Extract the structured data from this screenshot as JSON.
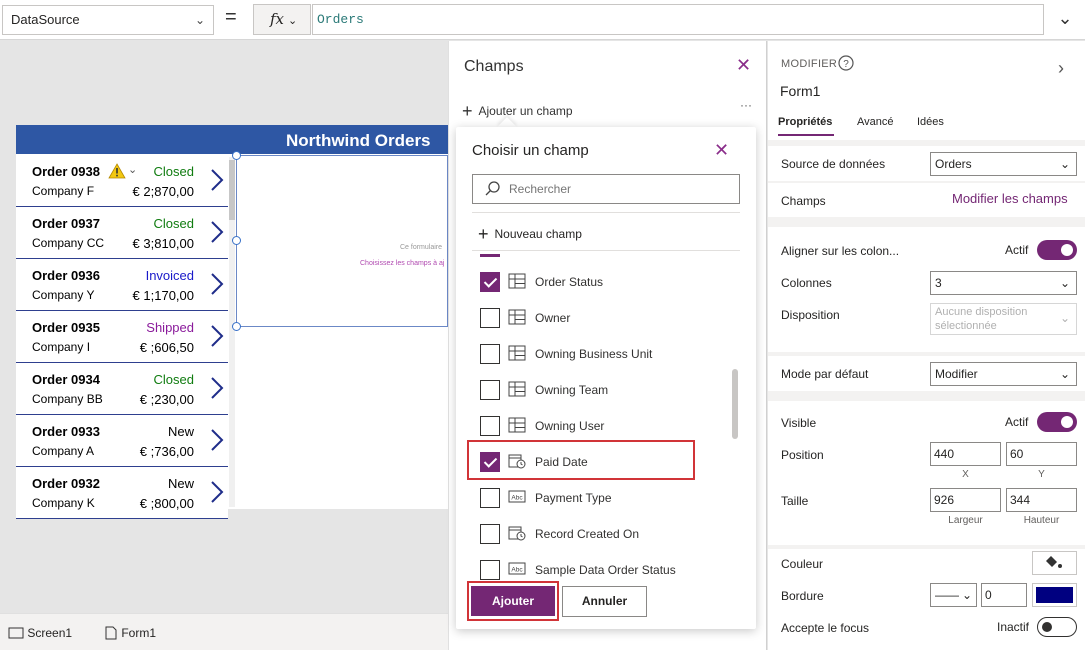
{
  "formula_bar": {
    "property": "DataSource",
    "equals": "=",
    "fx": "fx",
    "formula": "Orders"
  },
  "app": {
    "title": "Northwind Orders",
    "orders": [
      {
        "id": "Order 0938",
        "company": "Company F",
        "status": "Closed",
        "amount": "€ 2;870,00",
        "status_color": "#107c10"
      },
      {
        "id": "Order 0937",
        "company": "Company CC",
        "status": "Closed",
        "amount": "€ 3;810,00",
        "status_color": "#107c10"
      },
      {
        "id": "Order 0936",
        "company": "Company Y",
        "status": "Invoiced",
        "amount": "€ 1;170,00",
        "status_color": "#1a1ac9"
      },
      {
        "id": "Order 0935",
        "company": "Company I",
        "status": "Shipped",
        "amount": "€ ;606,50",
        "status_color": "#8a1a9b"
      },
      {
        "id": "Order 0934",
        "company": "Company BB",
        "status": "Closed",
        "amount": "€ ;230,00",
        "status_color": "#107c10"
      },
      {
        "id": "Order 0933",
        "company": "Company A",
        "status": "New",
        "amount": "€ ;736,00",
        "status_color": "#000000"
      },
      {
        "id": "Order 0932",
        "company": "Company K",
        "status": "New",
        "amount": "€ ;800,00",
        "status_color": "#000000"
      }
    ],
    "form_hint_1": "Ce formulaire",
    "form_hint_2": "Choisissez les champs à aj"
  },
  "breadcrumb": {
    "screen": "Screen1",
    "form": "Form1"
  },
  "champs_panel": {
    "title": "Champs",
    "add_field": "Ajouter un champ",
    "more": "···"
  },
  "choose_field": {
    "title": "Choisir un champ",
    "search_placeholder": "Rechercher",
    "new_field": "Nouveau champ",
    "fields": [
      {
        "label": "Order Status",
        "checked": true,
        "icon": "grid-field-icon"
      },
      {
        "label": "Owner",
        "checked": false,
        "icon": "grid-field-icon"
      },
      {
        "label": "Owning Business Unit",
        "checked": false,
        "icon": "grid-field-icon"
      },
      {
        "label": "Owning Team",
        "checked": false,
        "icon": "grid-field-icon"
      },
      {
        "label": "Owning User",
        "checked": false,
        "icon": "grid-field-icon"
      },
      {
        "label": "Paid Date",
        "checked": true,
        "icon": "calendar-clock-icon"
      },
      {
        "label": "Payment Type",
        "checked": false,
        "icon": "text-abc-icon"
      },
      {
        "label": "Record Created On",
        "checked": false,
        "icon": "calendar-clock-icon"
      },
      {
        "label": "Sample Data Order Status",
        "checked": false,
        "icon": "text-abc-icon"
      }
    ],
    "add_button": "Ajouter",
    "cancel_button": "Annuler"
  },
  "props": {
    "section": "MODIFIER",
    "control": "Form1",
    "tabs": [
      "Propriétés",
      "Avancé",
      "Idées"
    ],
    "data_source_label": "Source de données",
    "data_source_value": "Orders",
    "fields_label": "Champs",
    "edit_fields_link": "Modifier les champs",
    "align_label": "Aligner sur les colon...",
    "align_state": "Actif",
    "columns_label": "Colonnes",
    "columns_value": "3",
    "layout_label": "Disposition",
    "layout_value": "Aucune disposition sélectionnée",
    "default_mode_label": "Mode par défaut",
    "default_mode_value": "Modifier",
    "visible_label": "Visible",
    "visible_state": "Actif",
    "position_label": "Position",
    "pos_x": "440",
    "pos_y": "60",
    "x_label": "X",
    "y_label": "Y",
    "size_label": "Taille",
    "width": "926",
    "height": "344",
    "width_label": "Largeur",
    "height_label": "Hauteur",
    "color_label": "Couleur",
    "border_label": "Bordure",
    "border_style": "——",
    "border_width": "0",
    "border_color": "#000080",
    "focus_label": "Accepte le focus",
    "focus_state": "Inactif"
  },
  "colors": {
    "accent": "#742774",
    "app_header": "#2e57a4",
    "highlight": "#d13438"
  }
}
